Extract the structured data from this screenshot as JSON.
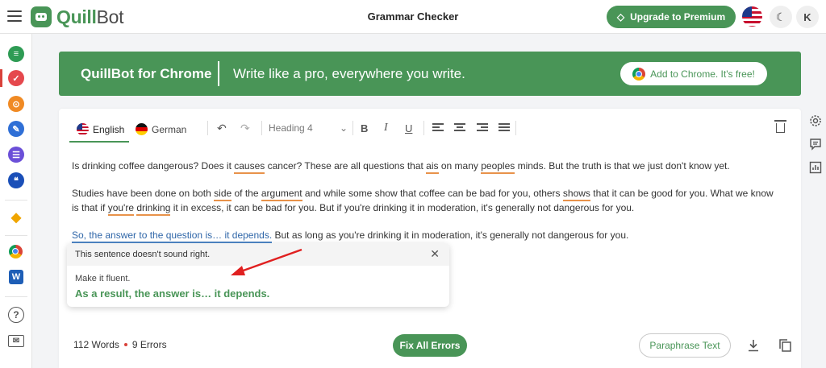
{
  "header": {
    "brand_prefix": "Quill",
    "brand_suffix": "Bot",
    "page_title": "Grammar Checker",
    "premium_label": "Upgrade to Premium",
    "avatar_initial": "K"
  },
  "banner": {
    "title": "QuillBot for Chrome",
    "tagline": "Write like a pro, everywhere you write.",
    "cta_label": "Add to Chrome. It's free!"
  },
  "toolbar": {
    "languages": [
      "English",
      "German"
    ],
    "heading_select": "Heading 4"
  },
  "editor": {
    "p1": {
      "a": "Is drinking coffee dangerous? Does it ",
      "e1": "causes",
      "b": " cancer? These are all questions that ",
      "e2": "ais",
      "c": " on many ",
      "e3": "peoples",
      "d": " minds. But the truth is that we just don't know yet."
    },
    "p2": {
      "a": "Studies have been done on both ",
      "e1": "side",
      "b": " of the ",
      "e2": "argument",
      "c": " and while some show that coffee can be bad for you, others ",
      "e3": "shows",
      "d": " that it can be good for you. What we know is that if ",
      "e4": "you're",
      "e": " ",
      "e5": "drinking",
      "f": " it in excess, it can be bad for you. But if you're drinking it in moderation, it's generally not dangerous for you."
    },
    "p3": {
      "hl": "So, the answer to the question is… it depends.",
      "rest": " But as long as you're drinking it in moderation, it's generally not dangerous for you."
    }
  },
  "popup": {
    "title": "This sentence doesn't sound right.",
    "hint": "Make it fluent.",
    "suggestion": "As a result, the answer is… it depends."
  },
  "footer": {
    "words": "112 Words",
    "errors": "9 Errors",
    "fix_all": "Fix All Errors",
    "paraphrase": "Paraphrase Text"
  },
  "colors": {
    "brand_green": "#499557",
    "error_underline": "#e8924a",
    "sentence_highlight": "#4f86c6",
    "annotation_arrow": "#e02020"
  }
}
